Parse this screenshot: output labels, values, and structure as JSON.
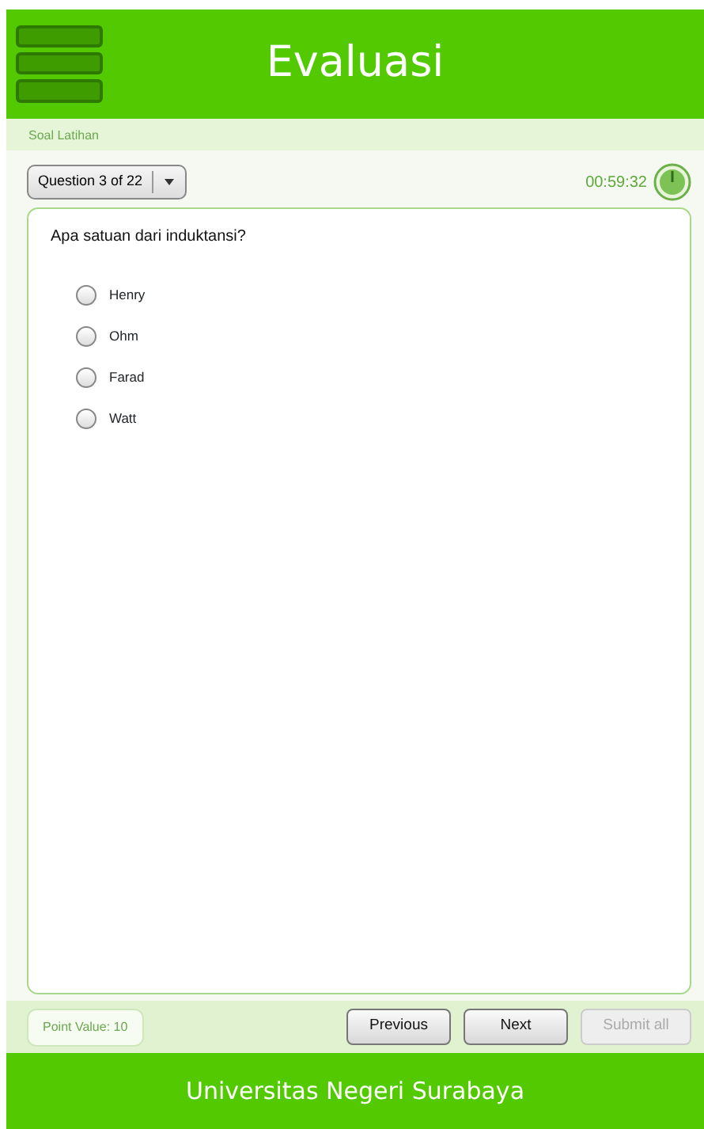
{
  "header": {
    "title": "Evaluasi"
  },
  "breadcrumb": "Soal Latihan",
  "question_selector": {
    "label": "Question 3 of 22"
  },
  "timer": "00:59:32",
  "question": {
    "text": "Apa satuan dari induktansi?",
    "options": [
      {
        "label": "Henry",
        "selected": false
      },
      {
        "label": "Ohm",
        "selected": false
      },
      {
        "label": "Farad",
        "selected": false
      },
      {
        "label": "Watt",
        "selected": false
      }
    ]
  },
  "point_value": "Point Value: 10",
  "buttons": [
    {
      "label": "Previous",
      "disabled": false
    },
    {
      "label": "Next",
      "disabled": false
    },
    {
      "label": "Submit all",
      "disabled": true
    }
  ],
  "footer": "Universitas Negeri Surabaya"
}
